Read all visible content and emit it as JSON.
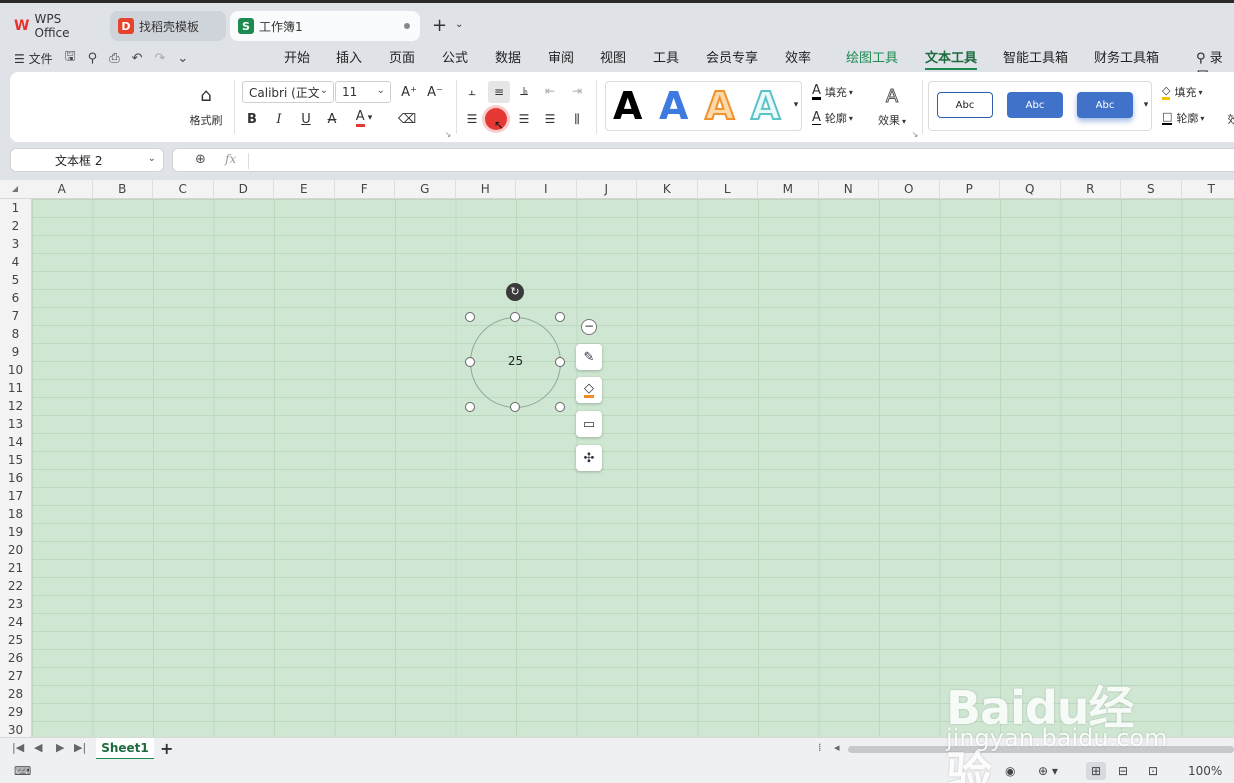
{
  "tabs": [
    {
      "label": "WPS Office"
    },
    {
      "label": "找稻壳模板"
    },
    {
      "label": "工作簿1"
    }
  ],
  "menubar": {
    "file_label": "文件",
    "items": [
      "开始",
      "插入",
      "页面",
      "公式",
      "数据",
      "审阅",
      "视图",
      "工具",
      "会员专享",
      "效率",
      "绘图工具",
      "文本工具",
      "智能工具箱",
      "财务工具箱"
    ],
    "record_label": "录屏"
  },
  "ribbon": {
    "format_painter": "格式刷",
    "font_name": "Calibri (正文)",
    "font_size": "11",
    "fill_label": "填充",
    "outline_label": "轮廓",
    "effect_label": "效果",
    "style_label": "Abc",
    "fill_label2": "填充",
    "outline_label2": "轮廓",
    "effect_label2": "效"
  },
  "namebox": {
    "value": "文本框 2"
  },
  "formula": {
    "fx": "fx"
  },
  "columns": [
    "A",
    "B",
    "C",
    "D",
    "E",
    "F",
    "G",
    "H",
    "I",
    "J",
    "K",
    "L",
    "M",
    "N",
    "O",
    "P",
    "Q",
    "R",
    "S",
    "T"
  ],
  "rows": [
    "1",
    "2",
    "3",
    "4",
    "5",
    "6",
    "7",
    "8",
    "9",
    "10",
    "11",
    "12",
    "13",
    "14",
    "15",
    "16",
    "17",
    "18",
    "19",
    "20",
    "21",
    "22",
    "23",
    "24",
    "25",
    "26",
    "27",
    "28",
    "29",
    "30"
  ],
  "shape": {
    "text": "25"
  },
  "sheets": [
    {
      "label": "Sheet1"
    }
  ],
  "status": {
    "zoom": "100%"
  },
  "watermark": {
    "brand": "Baidu经验",
    "url": "jingyan.baidu.com"
  },
  "colors": {
    "accent": "#1d8a4f",
    "grid_bg": "#cfe7d2",
    "ripple": "#e53935"
  }
}
